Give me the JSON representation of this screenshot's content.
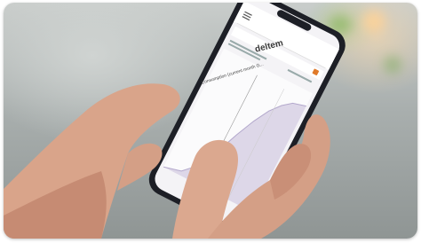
{
  "image": {
    "phone_app": {
      "brand_logo_text": "deltem",
      "menu_icon": "hamburger-menu-icon",
      "header_title": "Consumption (current month G...",
      "accent_color": "#e07a2a",
      "chart_color": "#c9c4d8"
    },
    "colors": {
      "skin": "#d9a48a",
      "skin_shadow": "#b97c64",
      "phone_body": "#1d1f26",
      "screen": "#f4f3f6"
    }
  }
}
